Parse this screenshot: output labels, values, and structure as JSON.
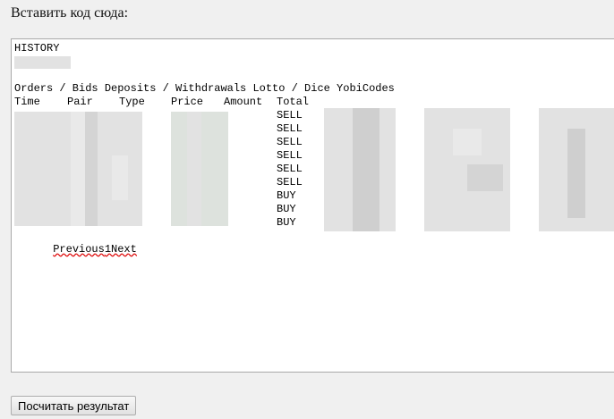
{
  "prompt_label": "Вставить код сюда:",
  "history": {
    "title": "HISTORY",
    "tabs_line": "Orders / Bids Deposits / Withdrawals Lotto / Dice YobiCodes",
    "columns": {
      "time": "Time",
      "pair": "Pair",
      "type": "Type",
      "price": "Price",
      "amount": "Amount",
      "total": "Total"
    },
    "types": [
      "SELL",
      "SELL",
      "SELL",
      "SELL",
      "SELL",
      "SELL",
      "BUY",
      "BUY",
      "BUY"
    ],
    "pagination": {
      "previous": "Previous",
      "page": "1",
      "next": "Next"
    }
  },
  "submit_button": "Посчитать результат"
}
